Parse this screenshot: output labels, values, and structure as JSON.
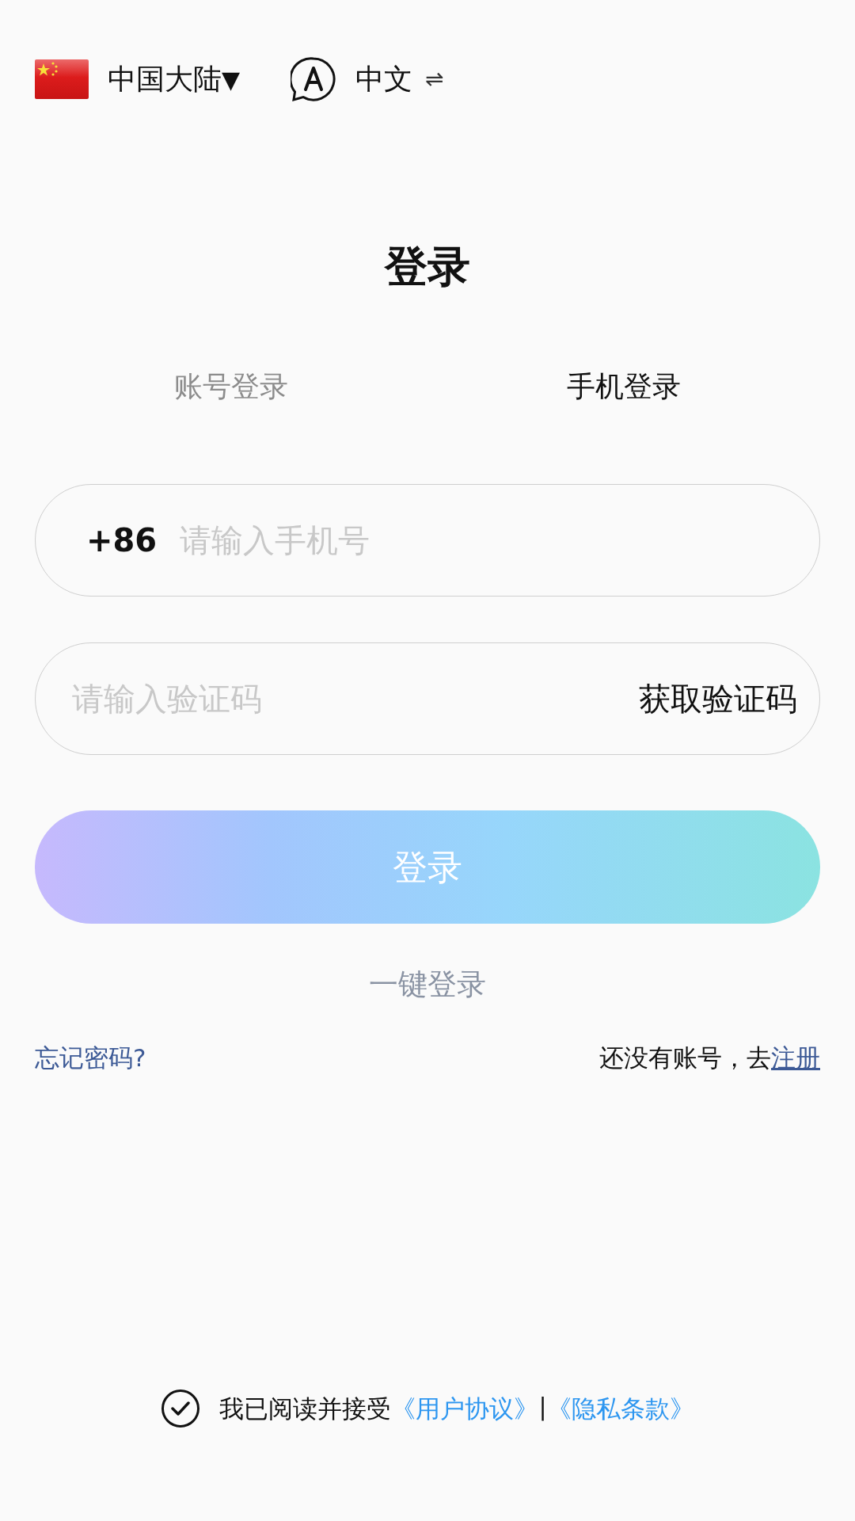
{
  "top_bar": {
    "region": "中国大陆",
    "region_caret": "▼",
    "language": "中文",
    "language_switch": "⇌"
  },
  "title": "登录",
  "tabs": [
    {
      "label": "账号登录",
      "selected": false
    },
    {
      "label": "手机登录",
      "selected": true
    }
  ],
  "phone_field": {
    "prefix": "+86",
    "placeholder": "请输入手机号"
  },
  "code_field": {
    "placeholder": "请输入验证码",
    "action": "获取验证码"
  },
  "login_button": "登录",
  "one_click_login": "一键登录",
  "forgot_password": "忘记密码?",
  "register": {
    "prompt": "还没有账号，去",
    "link": "注册"
  },
  "agreement": {
    "checked": true,
    "text": "我已阅读并接受",
    "user_agreement": "《用户协议》",
    "separator": "|",
    "privacy": "《隐私条款》"
  }
}
